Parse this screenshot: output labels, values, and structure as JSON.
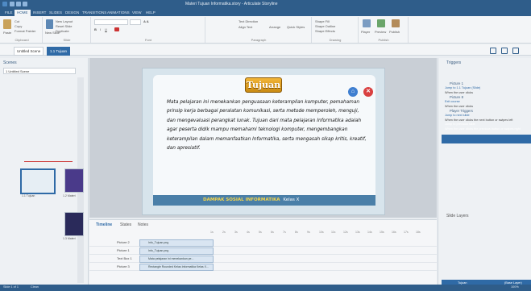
{
  "window": {
    "title": "Materi Tujuan Informatika.story - Articulate Storyline"
  },
  "ribbon": {
    "tabs": [
      "FILE",
      "HOME",
      "INSERT",
      "SLIDES",
      "DESIGN",
      "TRANSITIONS",
      "ANIMATIONS",
      "VIEW",
      "HELP"
    ],
    "active_tab": "HOME",
    "groups": {
      "clipboard": {
        "label": "Clipboard",
        "items": [
          "Cut",
          "Copy",
          "Paste",
          "Format Painter"
        ]
      },
      "slide": {
        "label": "Slide",
        "items": [
          "New Layout",
          "Reset Slide",
          "New Slide",
          "Duplicate"
        ]
      },
      "font": {
        "label": "Font"
      },
      "paragraph": {
        "label": "Paragraph",
        "items": [
          "Text Direction",
          "Align Text",
          "Arrange",
          "Quick Styles"
        ]
      },
      "drawing": {
        "label": "Drawing",
        "items": [
          "Shape Fill",
          "Shape Outline",
          "Shape Effects"
        ]
      },
      "publish": {
        "label": "Publish",
        "items": [
          "Player",
          "Preview",
          "Publish"
        ]
      }
    }
  },
  "view_tabs": [
    "Untitled Scene",
    "1.1 Tujuan"
  ],
  "active_view_tab": "1.1 Tujuan",
  "scenes_panel": {
    "title": "Scenes",
    "dropdown": "1 Untitled Scene",
    "thumbs": [
      {
        "label": "1.1 Tujuan"
      },
      {
        "label": "1.2 Materi"
      },
      {
        "label": "1.3 Materi"
      }
    ]
  },
  "slide": {
    "title": "Tujuan",
    "body": "Mata pelajaran ini menekankan penguasaan keterampilan komputer, pemahaman prinsip kerja berbagai peralatan komunikasi, serta metode memperoleh, menguji, dan mengevaluasi perangkat lunak. Tujuan dari mata pelajaran Informatika adalah agar peserta didik mampu memahami teknologi komputer, mengembangkan keterampilan dalam memanfaatkan Informatika, serta mengasah sikap kritis, kreatif, dan apresiatif.",
    "footer_left": "DAMPAK SOSIAL INFORMATIKA",
    "footer_right": "Kelas X"
  },
  "timeline": {
    "tabs": [
      "Timeline",
      "States",
      "Notes"
    ],
    "active_tab": "Timeline",
    "rows": [
      {
        "name": "Picture 2",
        "bar": "Info_Tujuan.png"
      },
      {
        "name": "Picture 1",
        "bar": "Info_Tujuan.png"
      },
      {
        "name": "Text Box 1",
        "bar": "Mata pelajaran ini menekankan pe..."
      },
      {
        "name": "Picture 3",
        "bar": "Rectangle Rounded Kelas Informatika Kelas X..."
      }
    ],
    "ticks": [
      "1s",
      "2s",
      "3s",
      "4s",
      "5s",
      "6s",
      "7s",
      "8s",
      "9s",
      "10s",
      "11s",
      "12s",
      "13s",
      "14s",
      "15s",
      "16s",
      "17s",
      "18s"
    ]
  },
  "triggers_panel": {
    "title": "Triggers",
    "items": [
      {
        "kind": "object",
        "label": "Picture 1"
      },
      {
        "kind": "text",
        "label": "Jump to 1.1 Tujuan (Slide)",
        "link": true
      },
      {
        "kind": "text",
        "label": "When the user clicks"
      },
      {
        "kind": "object",
        "label": "Picture 8"
      },
      {
        "kind": "text",
        "label": "Exit course",
        "link": true
      },
      {
        "kind": "text",
        "label": "When the user clicks"
      },
      {
        "kind": "object",
        "label": "Player Triggers"
      },
      {
        "kind": "text",
        "label": "Jump to next slide",
        "link": true
      },
      {
        "kind": "text",
        "label": "When the user clicks the next button or swipes left"
      },
      {
        "kind": "text",
        "label": "Jump to previous slide",
        "link": true,
        "selected": true
      },
      {
        "kind": "text",
        "label": "When the user clicks the previous button or swipes right",
        "selected": true
      }
    ]
  },
  "slide_layers": {
    "title": "Slide Layers",
    "base_layer": "Tujuan",
    "base_caption": "(Base Layer)"
  },
  "status": {
    "slide": "Slide 1 of 1",
    "label": "Clean",
    "zoom": "100%"
  },
  "colors": {
    "accent": "#2f6aa6",
    "titlebar": "#2f5d8a",
    "slide_title_badge": "#e8a52a",
    "footer_text": "#f4d54a"
  }
}
